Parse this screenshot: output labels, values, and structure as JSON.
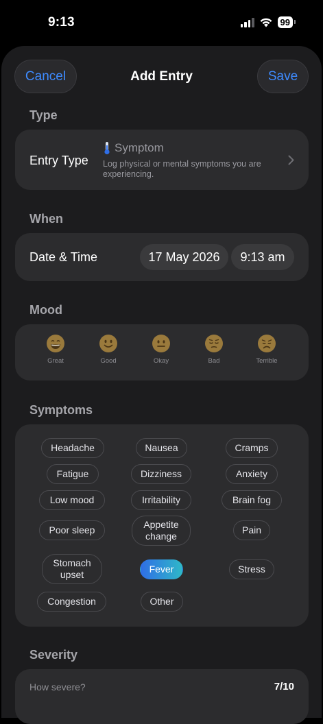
{
  "status": {
    "time": "9:13",
    "battery": "99"
  },
  "nav": {
    "cancel": "Cancel",
    "title": "Add Entry",
    "save": "Save"
  },
  "colors": {
    "accent": "#3e8bff",
    "card": "#2c2c2e",
    "sheet": "#1c1c1e"
  },
  "type_section": {
    "label": "Type",
    "row_label": "Entry Type",
    "value": "Symptom",
    "icon": "thermometer-icon",
    "description": "Log physical or mental symptoms you are experiencing."
  },
  "when_section": {
    "label": "When",
    "row_label": "Date & Time",
    "date": "17 May 2026",
    "time": "9:13 am"
  },
  "mood_section": {
    "label": "Mood",
    "options": [
      {
        "label": "Great",
        "icon": "grinning-face-icon"
      },
      {
        "label": "Good",
        "icon": "smiling-face-icon"
      },
      {
        "label": "Okay",
        "icon": "neutral-face-icon"
      },
      {
        "label": "Bad",
        "icon": "pensive-face-icon"
      },
      {
        "label": "Terrible",
        "icon": "sad-face-icon"
      }
    ]
  },
  "symptoms_section": {
    "label": "Symptoms",
    "chips": [
      {
        "label": "Headache",
        "selected": false
      },
      {
        "label": "Nausea",
        "selected": false
      },
      {
        "label": "Cramps",
        "selected": false
      },
      {
        "label": "Fatigue",
        "selected": false
      },
      {
        "label": "Dizziness",
        "selected": false
      },
      {
        "label": "Anxiety",
        "selected": false
      },
      {
        "label": "Low mood",
        "selected": false
      },
      {
        "label": "Irritability",
        "selected": false
      },
      {
        "label": "Brain fog",
        "selected": false
      },
      {
        "label": "Poor sleep",
        "selected": false
      },
      {
        "label": "Appetite change",
        "selected": false
      },
      {
        "label": "Pain",
        "selected": false
      },
      {
        "label": "Stomach upset",
        "selected": false
      },
      {
        "label": "Fever",
        "selected": true
      },
      {
        "label": "Stress",
        "selected": false
      },
      {
        "label": "Congestion",
        "selected": false
      },
      {
        "label": "Other",
        "selected": false
      }
    ]
  },
  "severity_section": {
    "label": "Severity",
    "question": "How severe?",
    "value": "7/10"
  }
}
